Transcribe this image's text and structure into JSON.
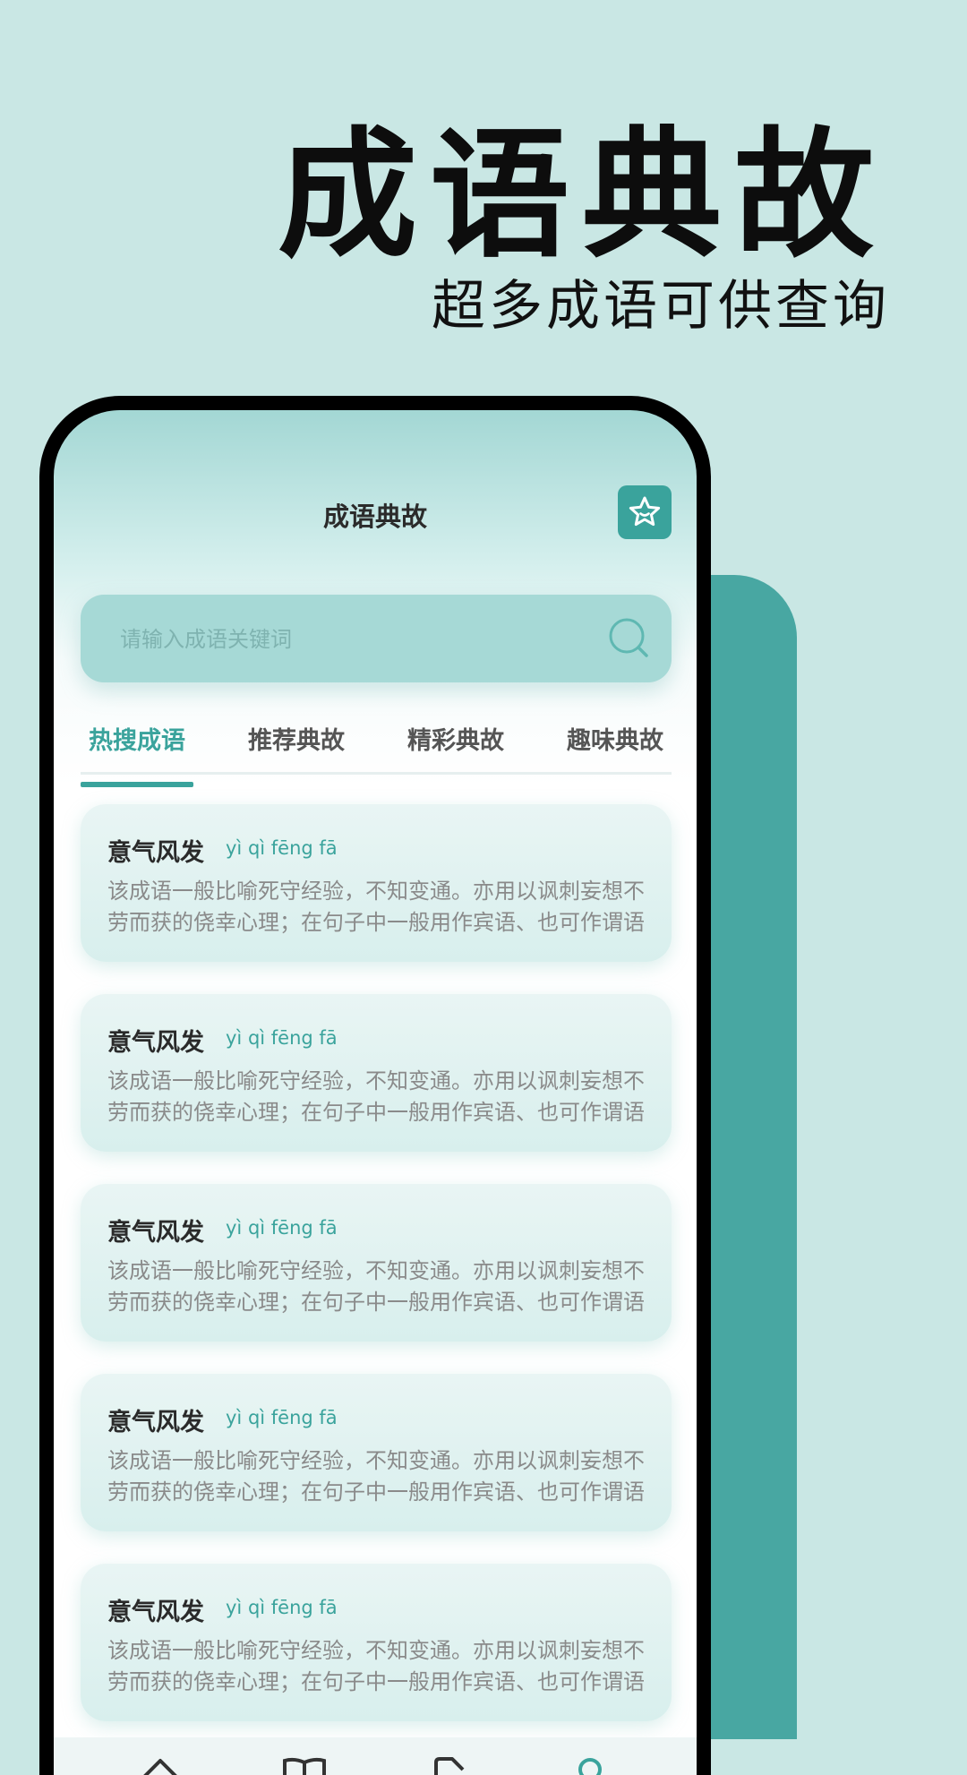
{
  "hero": {
    "title": "成语典故",
    "subtitle": "超多成语可供查询"
  },
  "app": {
    "title": "成语典故",
    "favorite_icon": "star-icon",
    "search": {
      "placeholder": "请输入成语关键词",
      "icon": "search-icon"
    },
    "tabs": [
      {
        "label": "热搜成语",
        "active": true
      },
      {
        "label": "推荐典故",
        "active": false
      },
      {
        "label": "精彩典故",
        "active": false
      },
      {
        "label": "趣味典故",
        "active": false
      }
    ],
    "cards": [
      {
        "name": "意气风发",
        "pinyin": "yì qì fēng fā",
        "desc": "该成语一般比喻死守经验，不知变通。亦用以讽刺妄想不劳而获的侥幸心理；在句子中一般用作宾语、也可作谓语"
      },
      {
        "name": "意气风发",
        "pinyin": "yì qì fēng fā",
        "desc": "该成语一般比喻死守经验，不知变通。亦用以讽刺妄想不劳而获的侥幸心理；在句子中一般用作宾语、也可作谓语"
      },
      {
        "name": "意气风发",
        "pinyin": "yì qì fēng fā",
        "desc": "该成语一般比喻死守经验，不知变通。亦用以讽刺妄想不劳而获的侥幸心理；在句子中一般用作宾语、也可作谓语"
      },
      {
        "name": "意气风发",
        "pinyin": "yì qì fēng fā",
        "desc": "该成语一般比喻死守经验，不知变通。亦用以讽刺妄想不劳而获的侥幸心理；在句子中一般用作宾语、也可作谓语"
      },
      {
        "name": "意气风发",
        "pinyin": "yì qì fēng fā",
        "desc": "该成语一般比喻死守经验，不知变通。亦用以讽刺妄想不劳而获的侥幸心理；在句子中一般用作宾语、也可作谓语"
      }
    ],
    "bottom_nav": [
      {
        "icon": "home-icon"
      },
      {
        "icon": "book-icon"
      },
      {
        "icon": "tag-icon"
      },
      {
        "icon": "profile-icon"
      }
    ]
  },
  "colors": {
    "background": "#c9e7e4",
    "accent": "#3aa39c",
    "accent_block": "#48a7a2"
  }
}
